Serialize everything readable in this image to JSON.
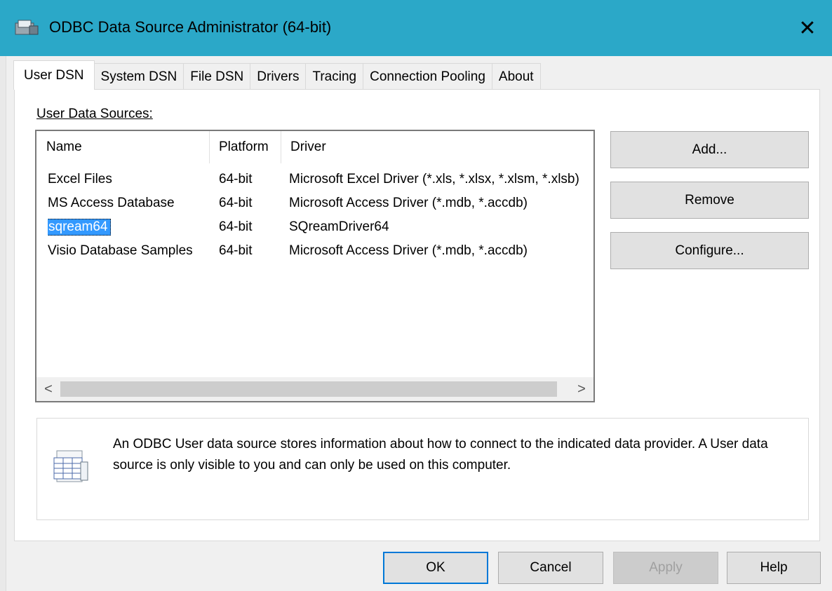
{
  "window": {
    "title": "ODBC Data Source Administrator (64-bit)",
    "close_glyph": "✕"
  },
  "tabs": [
    {
      "label": "User DSN",
      "active": true
    },
    {
      "label": "System DSN"
    },
    {
      "label": "File DSN"
    },
    {
      "label": "Drivers"
    },
    {
      "label": "Tracing"
    },
    {
      "label": "Connection Pooling"
    },
    {
      "label": "About"
    }
  ],
  "section": {
    "label": "User Data Sources:"
  },
  "list": {
    "columns": [
      "Name",
      "Platform",
      "Driver"
    ],
    "rows": [
      {
        "name": "Excel Files",
        "platform": "64-bit",
        "driver": "Microsoft Excel Driver (*.xls, *.xlsx, *.xlsm, *.xlsb)"
      },
      {
        "name": "MS Access Database",
        "platform": "64-bit",
        "driver": "Microsoft Access Driver (*.mdb, *.accdb)"
      },
      {
        "name": "sqream64",
        "platform": "64-bit",
        "driver": "SQreamDriver64",
        "selected": true
      },
      {
        "name": "Visio Database Samples",
        "platform": "64-bit",
        "driver": "Microsoft Access Driver (*.mdb, *.accdb)"
      }
    ],
    "scroll_left": "<",
    "scroll_right": ">"
  },
  "side_buttons": {
    "add": "Add...",
    "remove": "Remove",
    "configure": "Configure..."
  },
  "info": {
    "text": "An ODBC User data source stores information about how to connect to the indicated data provider.   A User data source is only visible to you and can only be used on this computer."
  },
  "footer": {
    "ok": "OK",
    "cancel": "Cancel",
    "apply": "Apply",
    "help": "Help"
  },
  "colors": {
    "titlebar": "#2ba8c8",
    "selection": "#3399ff",
    "default_button_border": "#0078d7"
  }
}
